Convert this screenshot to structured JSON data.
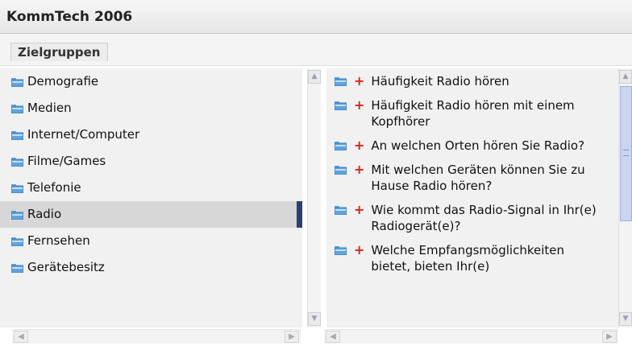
{
  "window": {
    "title": "KommTech 2006"
  },
  "tabs": [
    {
      "label": "Zielgruppen"
    }
  ],
  "categories": {
    "items": [
      {
        "label": "Demografie"
      },
      {
        "label": "Medien"
      },
      {
        "label": "Internet/Computer"
      },
      {
        "label": "Filme/Games"
      },
      {
        "label": "Telefonie"
      },
      {
        "label": "Radio"
      },
      {
        "label": "Fernsehen"
      },
      {
        "label": "Gerätebesitz"
      }
    ],
    "selected": "Radio"
  },
  "questions": {
    "items": [
      {
        "label": "Häufigkeit Radio hören"
      },
      {
        "label": "Häufigkeit Radio hören mit einem Kopfhörer"
      },
      {
        "label": "An welchen Orten hören Sie Radio?"
      },
      {
        "label": "Mit welchen Geräten können Sie zu Hause Radio hören?"
      },
      {
        "label": "Wie kommt das Radio-Signal in Ihr(e) Radiogerät(e)?"
      },
      {
        "label": "Welche Empfangsmöglichkeiten bietet, bieten Ihr(e)"
      }
    ]
  },
  "icons": {
    "folder": "folder-icon",
    "plus": "plus-icon"
  },
  "colors": {
    "folder": "#5fa3e0",
    "plus": "#e02020",
    "selection_bar": "#2e3e70",
    "scroll_thumb": "#c9d4ee"
  }
}
